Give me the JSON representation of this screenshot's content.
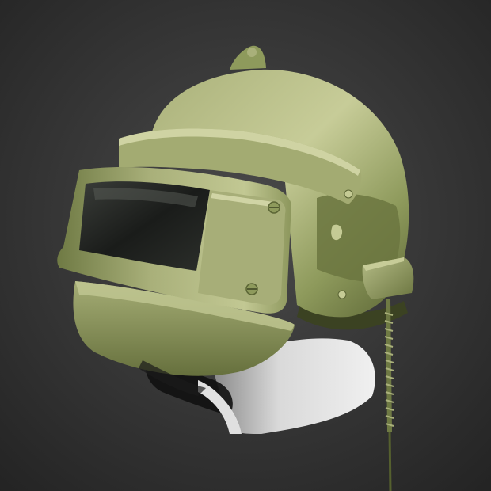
{
  "scene": {
    "subject": "helmet-render",
    "colors": {
      "background_center": "#4a4a4a",
      "background_edge": "#232323",
      "helmet_light": "#b9c08a",
      "helmet_mid": "#8e9a5c",
      "helmet_dark": "#5b6535",
      "helmet_shadow": "#3b4222",
      "visor_glass": "#1a1c1a",
      "mannequin_light": "#e8e8e8",
      "mannequin_dark": "#8a8a8a",
      "cable": "#8e9a5c"
    },
    "icons": [
      "screw-icon",
      "rivet-icon"
    ]
  }
}
